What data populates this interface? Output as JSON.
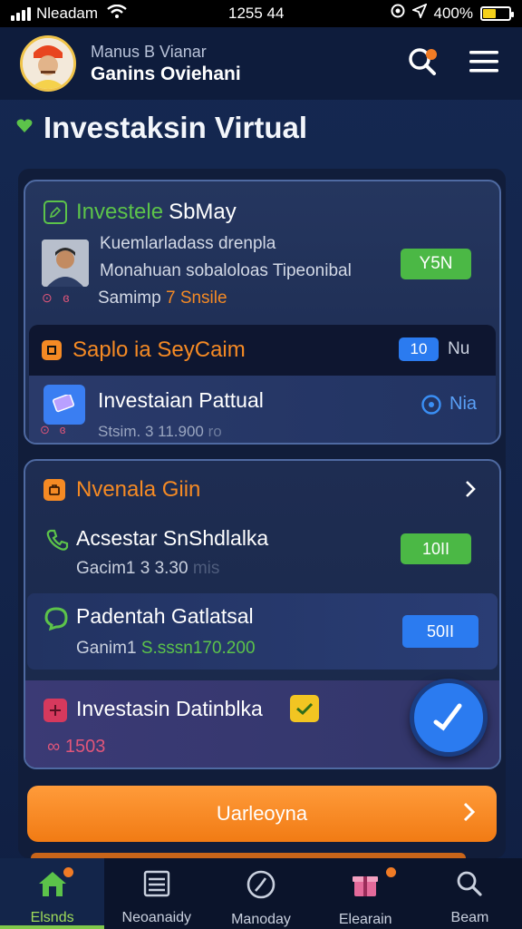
{
  "status_bar": {
    "carrier": "Nleadam",
    "time": "1255 44",
    "battery": "400%"
  },
  "header": {
    "user_subtitle": "Manus B Vianar",
    "user_name": "Ganins Oviehani"
  },
  "page_title": "Investaksin Virtual",
  "card1": {
    "title_green": "Investele",
    "title_white": "SbMay",
    "line1": "Kuemlarladass drenpla",
    "line2": "Monahuan sobaloloas Tipeonibal",
    "badge": "Y5N",
    "meta_prefix": "Samimp ",
    "meta_highlight": "7 Snsile",
    "sub_title": "Saplo ia SeyCaim",
    "sub_badge": "10",
    "sub_badge_label": "Nu",
    "row_title": "Investaian Pattual",
    "row_meta": "Stsim. 3 11.900",
    "row_right": "Nia",
    "row_meta_suffix": "ro"
  },
  "card2": {
    "title": "Nvenala Giin",
    "item1_title": "Acsestar SnShdlalka",
    "item1_meta": "Gacim1 3 3.30",
    "item1_meta_suffix": "mis",
    "item1_badge": "10II",
    "item2_title": "Padentah Gatlatsal",
    "item2_meta_prefix": "Ganim1 ",
    "item2_meta_highlight": "S.sssn170.200",
    "item2_badge": "50II",
    "item3_title": "Investasin Datinblka",
    "item3_meta": "1503"
  },
  "cta_label": "Uarleoyna",
  "tabs": [
    {
      "label": "Elsnds",
      "active": true
    },
    {
      "label": "Neoanaidy",
      "active": false
    },
    {
      "label": "Manoday",
      "active": false
    },
    {
      "label": "Elearain",
      "active": false
    },
    {
      "label": "Beam",
      "active": false
    }
  ],
  "colors": {
    "accent_orange": "#f58a24",
    "accent_green": "#5cc34a",
    "accent_blue": "#2b7bf0",
    "background": "#13244a"
  }
}
